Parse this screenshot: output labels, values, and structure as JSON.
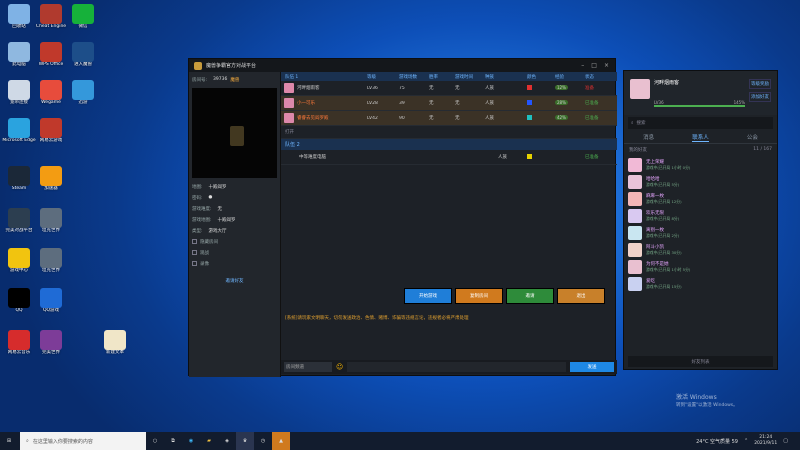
{
  "desktop_icons": [
    {
      "label": "回收站",
      "x": 0,
      "y": 0
    },
    {
      "label": "Cheat Engine",
      "x": 0,
      "y": 0
    },
    {
      "label": "微信",
      "x": 0,
      "y": 0
    },
    {
      "label": "此电脑",
      "x": 0,
      "y": 0
    },
    {
      "label": "WPS Office",
      "x": 0,
      "y": 0
    },
    {
      "label": "进入魔兽",
      "x": 0,
      "y": 0
    },
    {
      "label": "宽带连接",
      "x": 0,
      "y": 0
    },
    {
      "label": "Wegame",
      "x": 0,
      "y": 0
    },
    {
      "label": "迅游",
      "x": 0,
      "y": 0
    },
    {
      "label": "Microsoft Edge",
      "x": 0,
      "y": 0
    },
    {
      "label": "网易云游戏",
      "x": 0,
      "y": 0
    },
    {
      "label": "Steam",
      "x": 0,
      "y": 0
    },
    {
      "label": "加速器",
      "x": 0,
      "y": 0
    },
    {
      "label": "完美对战平台",
      "x": 0,
      "y": 0
    },
    {
      "label": "坦克世界",
      "x": 0,
      "y": 0
    },
    {
      "label": "游戏中心",
      "x": 0,
      "y": 0
    },
    {
      "label": "坦克世界",
      "x": 0,
      "y": 0
    },
    {
      "label": "QQ",
      "x": 0,
      "y": 0
    },
    {
      "label": "QQ游戏",
      "x": 0,
      "y": 0
    },
    {
      "label": "网易云音乐",
      "x": 0,
      "y": 0
    },
    {
      "label": "完美世界",
      "x": 0,
      "y": 0
    },
    {
      "label": "新建文本",
      "x": 0,
      "y": 0
    }
  ],
  "window": {
    "title": "魔兽争霸官方对战平台"
  },
  "room": {
    "number_label": "房间号:",
    "number": "39736",
    "name": "魔兽"
  },
  "room_info": [
    {
      "k": "地图:",
      "v": "十殿阎罗"
    },
    {
      "k": "密码:",
      "v": "●"
    },
    {
      "k": "游戏难度:",
      "v": "无"
    },
    {
      "k": "游戏地图:",
      "v": "十殿阎罗"
    },
    {
      "k": "类型:",
      "v": "游戏大厅"
    }
  ],
  "left_checks": [
    "隐藏房间",
    "观战",
    "录像"
  ],
  "left_btn": "邀请好友",
  "table": {
    "group1": "队伍 1",
    "headers": [
      "队伍 1",
      "等级",
      "游戏场数",
      "胜率",
      "游戏时间",
      "种族",
      "颜色",
      "经验",
      "状态"
    ],
    "rows": [
      {
        "name": "河畔烟雨客",
        "lv": "LV36",
        "games": "75",
        "win": "无",
        "time": "无",
        "race": "人族",
        "color": "#e03030",
        "exp": "12%",
        "status": "准备"
      },
      {
        "name": "小一可乐",
        "lv": "LV28",
        "games": "39",
        "win": "无",
        "time": "无",
        "race": "人族",
        "color": "#2255ff",
        "exp": "28%",
        "status": "已准备"
      },
      {
        "name": "睿睿去见阎罗殿",
        "lv": "LV42",
        "games": "90",
        "win": "无",
        "time": "无",
        "race": "人族",
        "color": "#1fbfbf",
        "exp": "42%",
        "status": "已准备"
      }
    ],
    "open_slot": "打开",
    "group2": "队伍 2",
    "row2": {
      "name": "中等难度电脑",
      "race": "人族",
      "color": "#e6d200",
      "status": "已准备"
    }
  },
  "actions": {
    "start": "开始游戏",
    "copy": "复制房间",
    "invite": "邀请",
    "quit": "退出"
  },
  "notice": "[系统]请玩家文明聊天，切勿发送政治、色情、赌博、诈骗等违规言论，违规者必将严肃处理",
  "chat": {
    "channel": "房间频道",
    "send": "发送"
  },
  "friends": {
    "me": "河畔烟雨客",
    "level": "LV36",
    "progress": "145%",
    "btn1": "等级奖励",
    "btn2": "添加好友",
    "search": "搜索",
    "tabs": [
      "消息",
      "联系人",
      "公会"
    ],
    "group_recent": "我的好友",
    "count": "11 / 167",
    "items": [
      {
        "name": "无上荣耀",
        "status": "游戏中(已开局 1小时 0分)"
      },
      {
        "name": "哈哈哈",
        "status": "游戏中(已开局 5分)"
      },
      {
        "name": "麻麻一枚",
        "status": "游戏中(已开局 12分)"
      },
      {
        "name": "欢乐无限",
        "status": "游戏中(已开局 8分)"
      },
      {
        "name": "离别一枚",
        "status": "游戏中(已开局 2分)"
      },
      {
        "name": "阿斗小凯",
        "status": "游戏中(已开局 30分)"
      },
      {
        "name": "为何不是她",
        "status": "游戏中(已开局 1小时 5分)"
      },
      {
        "name": "爱吃",
        "status": "游戏中(已开局 15分)"
      }
    ],
    "bottom": "好友列表"
  },
  "taskbar": {
    "search": "在这里输入你要搜索的内容",
    "temp": "24°C 空气质量 59",
    "time": "21:24",
    "date": "2021/9/11"
  },
  "watermark": {
    "line1": "激活 Windows",
    "line2": "转到\"设置\"以激活 Windows。"
  }
}
